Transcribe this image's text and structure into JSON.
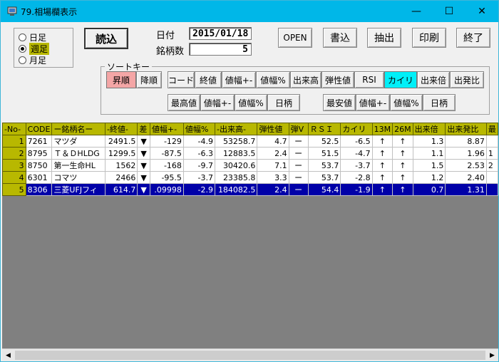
{
  "window": {
    "title": "79.相場欄表示",
    "minimize": "—",
    "maximize": "☐",
    "close": "✕",
    "title_color": "#00b7e8"
  },
  "period": {
    "options": [
      "日足",
      "週足",
      "月足"
    ],
    "selected": "週足"
  },
  "toolbar": {
    "load": "読込",
    "date_label": "日付",
    "date_value": "2015/01/18",
    "count_label": "銘柄数",
    "count_value": "5",
    "open": "OPEN",
    "write": "書込",
    "extract": "抽出",
    "print": "印刷",
    "exit": "終了"
  },
  "sort": {
    "legend": "ソートキー",
    "asc": "昇順",
    "desc": "降順",
    "row1": [
      "コード",
      "終値",
      "値幅+-",
      "値幅%",
      "出来高",
      "弾性値",
      "RSI",
      "カイリ",
      "出来倍",
      "出発比"
    ],
    "row2a": [
      "最高値",
      "値幅+-",
      "値幅%",
      "日柄"
    ],
    "row2b": [
      "最安値",
      "値幅+-",
      "値幅%",
      "日柄"
    ],
    "active_key": "カイリ",
    "active_order": "昇順"
  },
  "table": {
    "headers": [
      "-No-",
      "CODE",
      "ー銘柄名ー",
      "-終値-",
      "差",
      "値幅+-",
      "値幅%",
      "-出来高-",
      "弾性値",
      "弾V",
      "ＲＳＩ",
      "カイリ",
      "13M",
      "26M",
      "出来倍",
      "出来発比",
      "最"
    ],
    "rows": [
      [
        "1",
        "7261",
        "マツダ",
        "2491.5",
        "▼",
        "-129",
        "-4.9",
        "53258.7",
        "4.7",
        "ー",
        "52.5",
        "-6.5",
        "↑",
        "↑",
        "1.3",
        "8.87",
        ""
      ],
      [
        "2",
        "8795",
        "Ｔ＆ＤHLDG",
        "1299.5",
        "▼",
        "-87.5",
        "-6.3",
        "12883.5",
        "2.4",
        "ー",
        "51.5",
        "-4.7",
        "↑",
        "↑",
        "1.1",
        "1.96",
        "1"
      ],
      [
        "3",
        "8750",
        "第一生命HL",
        "1562",
        "▼",
        "-168",
        "-9.7",
        "30420.6",
        "7.1",
        "ー",
        "53.7",
        "-3.7",
        "↑",
        "↑",
        "1.5",
        "2.53",
        "2"
      ],
      [
        "4",
        "6301",
        "コマツ",
        "2466",
        "▼",
        "-95.5",
        "-3.7",
        "23385.8",
        "3.3",
        "ー",
        "53.7",
        "-2.8",
        "↑",
        "↑",
        "1.2",
        "2.40",
        ""
      ],
      [
        "5",
        "8306",
        "三菱UFJフィ",
        "614.7",
        "▼",
        ".09998",
        "-2.9",
        "184082.5",
        "2.4",
        "ー",
        "54.4",
        "-1.9",
        "↑",
        "↑",
        "0.7",
        "1.31",
        ""
      ]
    ],
    "selected_row": 5,
    "header_color": "#b8b800",
    "selection_color": "#0000a8"
  }
}
